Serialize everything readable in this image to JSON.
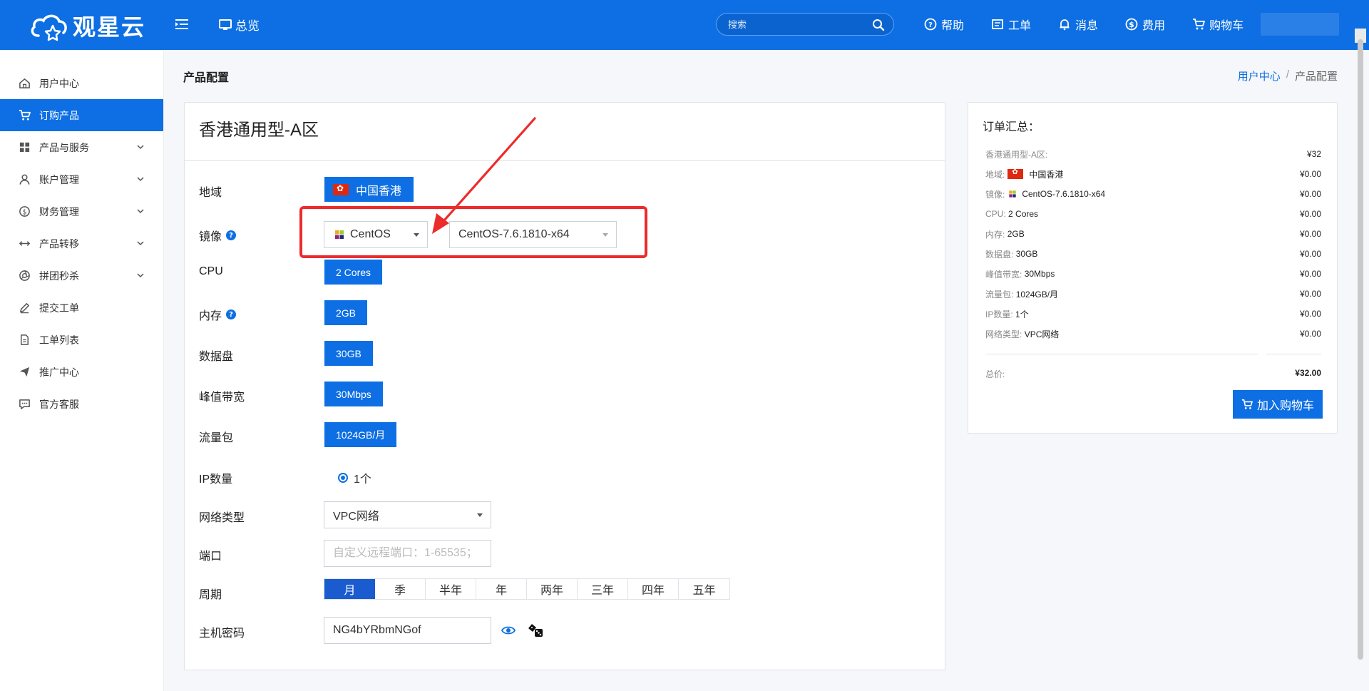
{
  "header": {
    "logo_text": "观星云",
    "overview_label": "总览",
    "search_placeholder": "搜索",
    "links": [
      {
        "label": "帮助",
        "icon": "help-circle-icon"
      },
      {
        "label": "工单",
        "icon": "ticket-icon"
      },
      {
        "label": "消息",
        "icon": "bell-icon"
      },
      {
        "label": "费用",
        "icon": "dollar-circle-icon"
      },
      {
        "label": "购物车",
        "icon": "cart-icon"
      }
    ]
  },
  "sidebar": {
    "items": [
      {
        "label": "用户中心",
        "icon": "home-icon",
        "active": false,
        "expandable": false
      },
      {
        "label": "订购产品",
        "icon": "cart-icon",
        "active": true,
        "expandable": false
      },
      {
        "label": "产品与服务",
        "icon": "grid-icon",
        "active": false,
        "expandable": true
      },
      {
        "label": "账户管理",
        "icon": "user-icon",
        "active": false,
        "expandable": true
      },
      {
        "label": "财务管理",
        "icon": "dollar-circle-icon",
        "active": false,
        "expandable": true
      },
      {
        "label": "产品转移",
        "icon": "transfer-icon",
        "active": false,
        "expandable": true
      },
      {
        "label": "拼团秒杀",
        "icon": "aperture-icon",
        "active": false,
        "expandable": true
      },
      {
        "label": "提交工单",
        "icon": "edit-icon",
        "active": false,
        "expandable": false
      },
      {
        "label": "工单列表",
        "icon": "document-icon",
        "active": false,
        "expandable": false
      },
      {
        "label": "推广中心",
        "icon": "send-icon",
        "active": false,
        "expandable": false
      },
      {
        "label": "官方客服",
        "icon": "chat-icon",
        "active": false,
        "expandable": false
      }
    ]
  },
  "page": {
    "title": "产品配置",
    "breadcrumb": {
      "home": "用户中心",
      "separator": "/",
      "current": "产品配置"
    }
  },
  "config": {
    "product_name": "香港通用型-A区",
    "labels": {
      "region": "地域",
      "image": "镜像",
      "cpu": "CPU",
      "memory": "内存",
      "disk": "数据盘",
      "bandwidth": "峰值带宽",
      "traffic": "流量包",
      "ip_count": "IP数量",
      "network": "网络类型",
      "port": "端口",
      "period": "周期",
      "password": "主机密码"
    },
    "region_value": "中国香港",
    "os_value": "CentOS",
    "os_version_value": "CentOS-7.6.1810-x64",
    "cpu_value": "2 Cores",
    "memory_value": "2GB",
    "disk_value": "30GB",
    "bandwidth_value": "30Mbps",
    "traffic_value": "1024GB/月",
    "ip_value": "1个",
    "network_value": "VPC网络",
    "port_placeholder": "自定义远程端口：1-65535；",
    "periods": [
      "月",
      "季",
      "半年",
      "年",
      "两年",
      "三年",
      "四年",
      "五年"
    ],
    "period_selected": "月",
    "password_value": "NG4bYRbmNGof"
  },
  "summary": {
    "title": "订单汇总：",
    "rows": [
      {
        "label": "香港通用型-A区:",
        "value": "",
        "price": "¥32"
      },
      {
        "label": "地域:",
        "value": "中国香港",
        "price": "¥0.00"
      },
      {
        "label": "镜像:",
        "value": "CentOS-7.6.1810-x64",
        "price": "¥0.00"
      },
      {
        "label": "CPU:",
        "value": "2 Cores",
        "price": "¥0.00"
      },
      {
        "label": "内存:",
        "value": "2GB",
        "price": "¥0.00"
      },
      {
        "label": "数据盘:",
        "value": "30GB",
        "price": "¥0.00"
      },
      {
        "label": "峰值带宽:",
        "value": "30Mbps",
        "price": "¥0.00"
      },
      {
        "label": "流量包:",
        "value": "1024GB/月",
        "price": "¥0.00"
      },
      {
        "label": "IP数量:",
        "value": "1个",
        "price": "¥0.00"
      },
      {
        "label": "网络类型:",
        "value": "VPC网络",
        "price": "¥0.00"
      }
    ],
    "total_label": "总价:",
    "total_value": "¥32.00",
    "add_to_cart": "加入购物车"
  },
  "colors": {
    "brand": "#0d6fe3",
    "highlight": "#ec2b2b",
    "period_active": "#1a5ccf"
  }
}
